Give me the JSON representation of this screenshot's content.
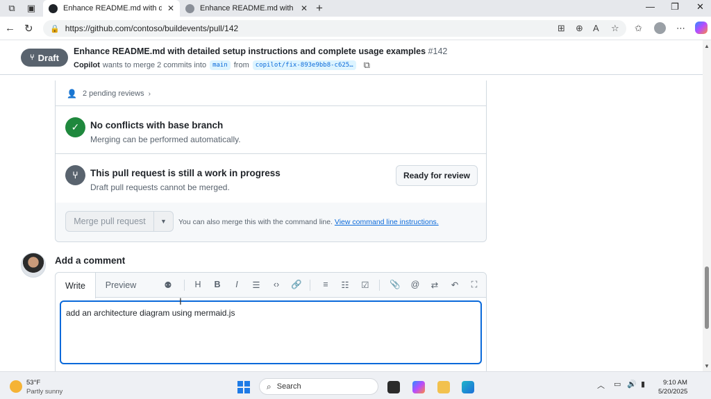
{
  "browser": {
    "tabs": [
      {
        "title": "Enhance README.md with detaile",
        "active": true
      },
      {
        "title": "Enhance README.md with compr",
        "active": false
      }
    ],
    "url": "https://github.com/contoso/buildevents/pull/142"
  },
  "pr": {
    "state_label": "Draft",
    "title": "Enhance README.md with detailed setup instructions and complete usage examples",
    "number": "#142",
    "author": "Copilot",
    "merge_text": "wants to merge 2 commits into",
    "base_branch": "main",
    "from_text": "from",
    "head_branch": "copilot/fix-893e9bb8-c625…"
  },
  "merge_box": {
    "pending_reviews": "2 pending reviews",
    "conflicts_title": "No conflicts with base branch",
    "conflicts_sub": "Merging can be performed automatically.",
    "wip_title": "This pull request is still a work in progress",
    "wip_sub": "Draft pull requests cannot be merged.",
    "ready_button": "Ready for review",
    "merge_button": "Merge pull request",
    "merge_note": "You can also merge this with the command line.",
    "merge_link": "View command line instructions."
  },
  "comment": {
    "heading": "Add a comment",
    "tab_write": "Write",
    "tab_preview": "Preview",
    "text": "add an architecture diagram using mermaid.js"
  },
  "taskbar": {
    "temp": "53°F",
    "weather": "Partly sunny",
    "search_placeholder": "Search",
    "time": "9:10 AM",
    "date": "5/20/2025"
  },
  "colors": {
    "success": "#1f883d",
    "neutral": "#59636e",
    "link": "#0969da",
    "focus_border": "#0969da"
  }
}
